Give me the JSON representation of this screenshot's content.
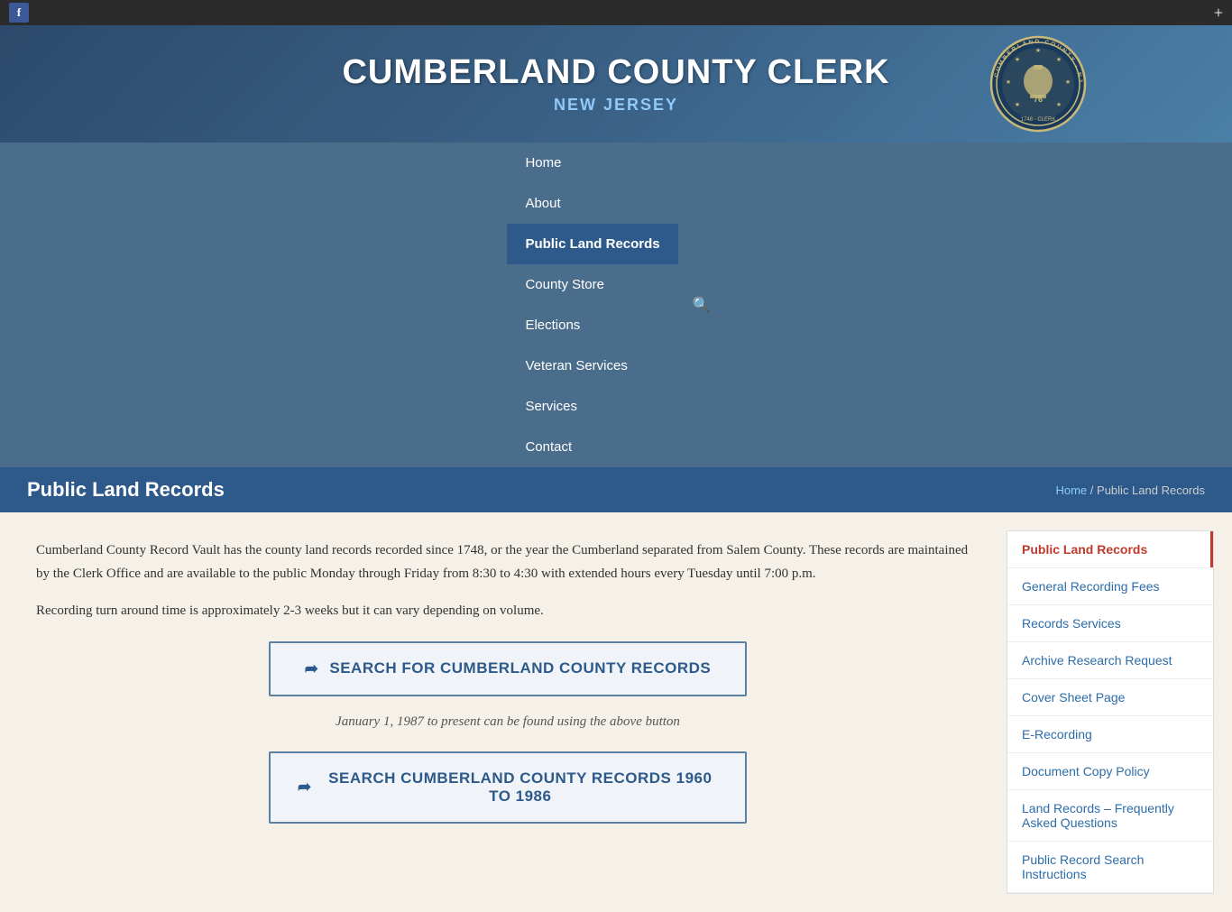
{
  "topbar": {
    "facebook_label": "f",
    "plus_label": "+"
  },
  "header": {
    "title": "CUMBERLAND COUNTY CLERK",
    "subtitle": "NEW JERSEY",
    "seal_alt": "Cumberland County NJ Seal"
  },
  "nav": {
    "items": [
      {
        "label": "Home",
        "active": false,
        "id": "home"
      },
      {
        "label": "About",
        "active": false,
        "id": "about"
      },
      {
        "label": "Public Land Records",
        "active": true,
        "id": "public-land-records"
      },
      {
        "label": "County Store",
        "active": false,
        "id": "county-store"
      },
      {
        "label": "Elections",
        "active": false,
        "id": "elections"
      },
      {
        "label": "Veteran Services",
        "active": false,
        "id": "veteran-services"
      },
      {
        "label": "Services",
        "active": false,
        "id": "services"
      },
      {
        "label": "Contact",
        "active": false,
        "id": "contact"
      }
    ]
  },
  "page": {
    "title": "Public Land Records",
    "breadcrumb_home": "Home",
    "breadcrumb_current": "Public Land Records"
  },
  "content": {
    "paragraph1": "Cumberland County Record Vault has the county land records recorded since 1748, or the year the Cumberland separated from Salem County.  These records are maintained by the Clerk Office and are available to the public Monday through Friday from 8:30 to 4:30 with extended hours every Tuesday until 7:00 p.m.",
    "paragraph2": "Recording turn around time is approximately 2-3 weeks but it can vary depending on volume.",
    "search_btn1": "SEARCH FOR CUMBERLAND COUNTY RECORDS",
    "date_note": "January 1, 1987 to present can be found using the above button",
    "search_btn2": "SEARCH CUMBERLAND COUNTY RECORDS 1960 TO 1986"
  },
  "sidebar": {
    "items": [
      {
        "label": "Public Land Records",
        "active": true,
        "id": "plr"
      },
      {
        "label": "General Recording Fees",
        "active": false,
        "id": "grf"
      },
      {
        "label": "Records Services",
        "active": false,
        "id": "rs"
      },
      {
        "label": "Archive Research Request",
        "active": false,
        "id": "arr"
      },
      {
        "label": "Cover Sheet Page",
        "active": false,
        "id": "csp"
      },
      {
        "label": "E-Recording",
        "active": false,
        "id": "er"
      },
      {
        "label": "Document Copy Policy",
        "active": false,
        "id": "dcp"
      },
      {
        "label": "Land Records – Frequently Asked Questions",
        "active": false,
        "id": "lrfaq"
      },
      {
        "label": "Public Record Search Instructions",
        "active": false,
        "id": "prsi"
      }
    ]
  },
  "icons": {
    "search": "🔍",
    "share": "↗"
  }
}
